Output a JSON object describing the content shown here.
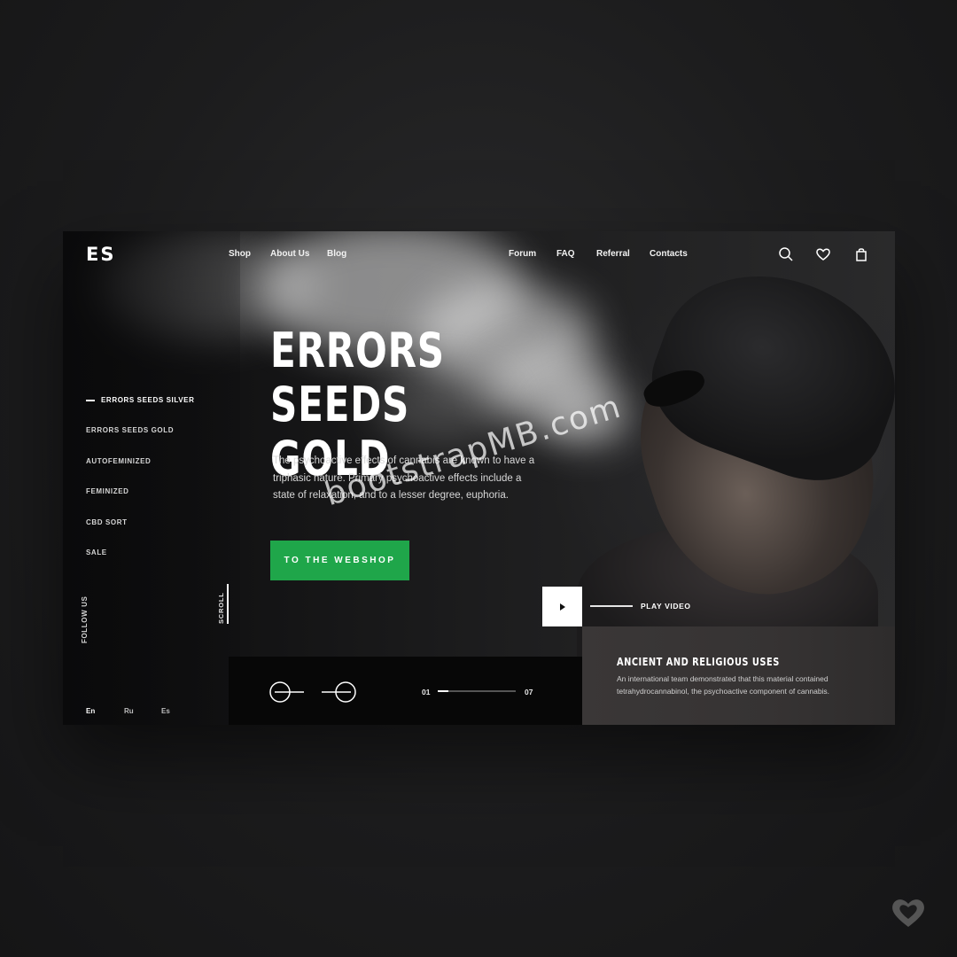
{
  "brand": {
    "logo": "ES"
  },
  "nav": {
    "left": [
      "Shop",
      "About Us",
      "Blog"
    ],
    "right": [
      "Forum",
      "FAQ",
      "Referral",
      "Contacts"
    ]
  },
  "header_icons": [
    "search-icon",
    "heart-icon",
    "shopping-bag-icon"
  ],
  "side_menu": {
    "items": [
      "ERRORS SEEDS SILVER",
      "ERRORS SEEDS GOLD",
      "AUTOFEMINIZED",
      "FEMINIZED",
      "CBD SORT",
      "SALE"
    ],
    "active_index": 0
  },
  "follow_label": "FOLLOW US",
  "languages": {
    "items": [
      "En",
      "Ru",
      "Es"
    ],
    "selected": "En"
  },
  "hero": {
    "title_line1": "ERRORS SEEDS",
    "title_line2": "GOLD",
    "description": "The psychoactive effects of cannabis are known to have a triphasic nature. Primary psychoactive effects include a state of relaxation, and to a lesser degree, euphoria.",
    "cta_label": "TO THE WEBSHOP"
  },
  "scroll_label": "SCROLL",
  "video": {
    "label": "PLAY VIDEO"
  },
  "slider": {
    "current": "01",
    "total": "07",
    "progress": 0.14
  },
  "info_card": {
    "title": "ANCIENT AND RELIGIOUS USES",
    "text": "An international team demonstrated that this material contained tetrahydrocannabinol, the psychoactive component of cannabis."
  },
  "watermark": "bootstrapMB.com",
  "colors": {
    "accent": "#1fa64a",
    "background": "#1c1c1d",
    "card": "#363333"
  }
}
